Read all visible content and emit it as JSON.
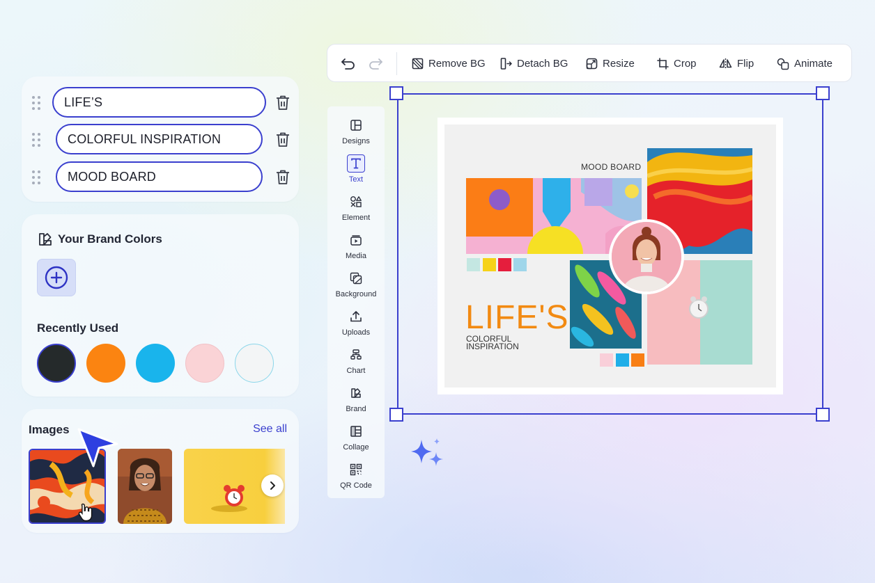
{
  "text_fields": [
    {
      "value": "LIFE’S"
    },
    {
      "value": "COLORFUL INSPIRATION"
    },
    {
      "value": "MOOD BOARD"
    }
  ],
  "brand_colors": {
    "title": "Your Brand Colors",
    "recently_used_title": "Recently Used",
    "recent_swatches": [
      "#252a2b",
      "#fb8411",
      "#19b4ec",
      "#fad3d6",
      "#f3f5f6"
    ]
  },
  "images": {
    "title": "Images",
    "see_all_label": "See all"
  },
  "toolbar": {
    "remove_bg": "Remove BG",
    "detach_bg": "Detach BG",
    "resize": "Resize",
    "crop": "Crop",
    "flip": "Flip",
    "animate": "Animate"
  },
  "side_rail": [
    {
      "label": "Designs",
      "icon": "layout-icon"
    },
    {
      "label": "Text",
      "icon": "text-icon"
    },
    {
      "label": "Element",
      "icon": "shapes-icon"
    },
    {
      "label": "Media",
      "icon": "media-icon"
    },
    {
      "label": "Background",
      "icon": "background-icon"
    },
    {
      "label": "Uploads",
      "icon": "upload-icon"
    },
    {
      "label": "Chart",
      "icon": "chart-icon"
    },
    {
      "label": "Brand",
      "icon": "brand-icon"
    },
    {
      "label": "Collage",
      "icon": "collage-icon"
    },
    {
      "label": "QR Code",
      "icon": "qr-code-icon"
    }
  ],
  "board": {
    "heading": "MOOD BOARD",
    "title": "LIFE'S",
    "subtitle": "COLORFUL INSPIRATION"
  },
  "colors": {
    "accent": "#3a3fce",
    "title_orange": "#f28a12"
  }
}
